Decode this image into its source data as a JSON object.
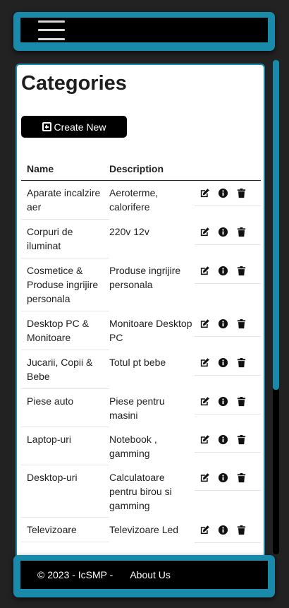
{
  "page": {
    "title": "Categories"
  },
  "toolbar": {
    "create_label": "Create New"
  },
  "table": {
    "headers": [
      "Name",
      "Description"
    ],
    "rows": [
      {
        "name": "Aparate incalzire aer",
        "description": "Aeroterme, calorifere"
      },
      {
        "name": "Corpuri de iluminat",
        "description": "220v 12v"
      },
      {
        "name": "Cosmetice & Produse ingrijire personala",
        "description": "Produse ingrijire personala"
      },
      {
        "name": "Desktop PC & Monitoare",
        "description": "Monitoare Desktop PC"
      },
      {
        "name": "Jucarii, Copii & Bebe",
        "description": "Totul pt bebe"
      },
      {
        "name": "Piese auto",
        "description": "Piese pentru masini"
      },
      {
        "name": "Laptop-uri",
        "description": "Notebook , gamming"
      },
      {
        "name": "Desktop-uri",
        "description": "Calculatoare pentru birou si gamming"
      },
      {
        "name": "Televizoare",
        "description": "Televizoare Led"
      }
    ],
    "action_icons": [
      "edit-icon",
      "info-icon",
      "trash-icon"
    ]
  },
  "footer": {
    "copyright": "© 2023 - IcSMP -",
    "about_label": "About Us"
  },
  "colors": {
    "accent": "#1a8aaa",
    "bar": "#000000",
    "page_bg": "#222222"
  }
}
